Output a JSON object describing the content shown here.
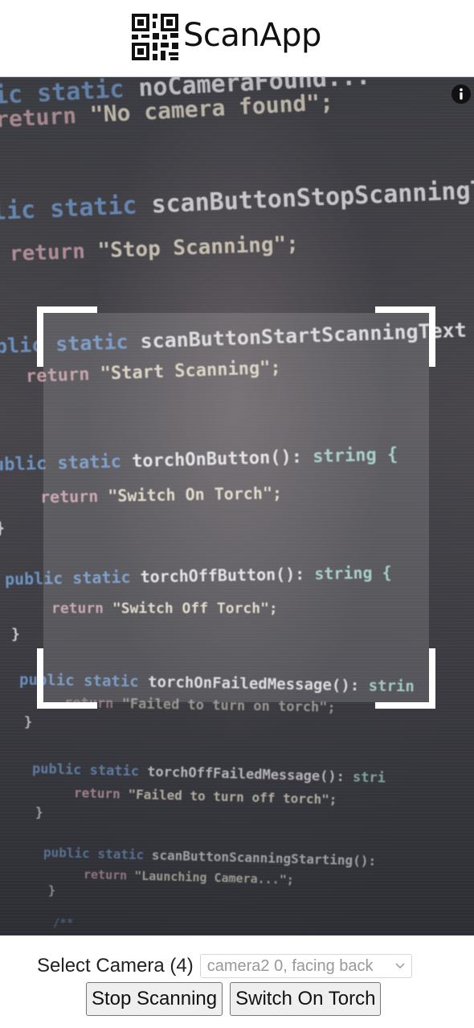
{
  "header": {
    "title": "ScanApp",
    "logo_icon": "qr-code-icon"
  },
  "viewfinder": {
    "info_icon": "info-icon",
    "code_lines": [
      {
        "t": [
          [
            "kw",
            "ic static "
          ],
          [
            "fn",
            "noCameraFound..."
          ]
        ]
      },
      {
        "t": [
          [
            "ret",
            "return "
          ],
          [
            "str",
            "\"No camera found\";"
          ]
        ]
      },
      {
        "t": [
          [
            "kw",
            "lic static "
          ],
          [
            "fn",
            "scanButtonStopScanningText("
          ]
        ]
      },
      {
        "t": [
          [
            "ret",
            "return "
          ],
          [
            "str",
            "\"Stop Scanning\";"
          ]
        ]
      },
      {
        "t": [
          [
            "kw",
            "blic static "
          ],
          [
            "fn",
            "scanButtonStartScanningText"
          ]
        ]
      },
      {
        "t": [
          [
            "ret",
            "return "
          ],
          [
            "str",
            "\"Start Scanning\";"
          ]
        ]
      },
      {
        "t": [
          [
            "kw",
            "ublic static "
          ],
          [
            "fn",
            "torchOnButton(): "
          ],
          [
            "ty",
            "string {"
          ]
        ]
      },
      {
        "t": [
          [
            "ret",
            "return "
          ],
          [
            "str",
            "\"Switch On Torch\";"
          ]
        ]
      },
      {
        "t": [
          [
            "fn",
            "}"
          ]
        ]
      },
      {
        "t": [
          [
            "kw",
            "public static "
          ],
          [
            "fn",
            "torchOffButton(): "
          ],
          [
            "ty",
            "string {"
          ]
        ]
      },
      {
        "t": [
          [
            "ret",
            "return "
          ],
          [
            "str",
            "\"Switch Off Torch\";"
          ]
        ]
      },
      {
        "t": [
          [
            "fn",
            "}"
          ]
        ]
      },
      {
        "t": [
          [
            "kw",
            "public static "
          ],
          [
            "fn",
            "torchOnFailedMessage(): "
          ],
          [
            "ty",
            "strin"
          ]
        ]
      },
      {
        "t": [
          [
            "ret",
            "return "
          ],
          [
            "str",
            "\"Failed to turn on torch\";"
          ]
        ]
      },
      {
        "t": [
          [
            "fn",
            "}"
          ]
        ]
      },
      {
        "t": [
          [
            "kw",
            "public static "
          ],
          [
            "fn",
            "torchOffFailedMessage(): "
          ],
          [
            "ty",
            "stri"
          ]
        ]
      },
      {
        "t": [
          [
            "ret",
            "return "
          ],
          [
            "str",
            "\"Failed to turn off torch\";"
          ]
        ]
      },
      {
        "t": [
          [
            "fn",
            "}"
          ]
        ]
      },
      {
        "t": [
          [
            "kw",
            "public static "
          ],
          [
            "fn",
            "scanButtonScanningStarting():"
          ]
        ]
      },
      {
        "t": [
          [
            "ret",
            "return "
          ],
          [
            "str",
            "\"Launching Camera...\";"
          ]
        ]
      },
      {
        "t": [
          [
            "fn",
            "}"
          ]
        ]
      },
      {
        "t": [
          [
            "kw",
            "/**"
          ]
        ]
      }
    ]
  },
  "controls": {
    "select_camera_label": "Select Camera (4)",
    "camera_selected": "camera2 0, facing back",
    "stop_scanning_label": "Stop Scanning",
    "switch_torch_label": "Switch On Torch"
  }
}
